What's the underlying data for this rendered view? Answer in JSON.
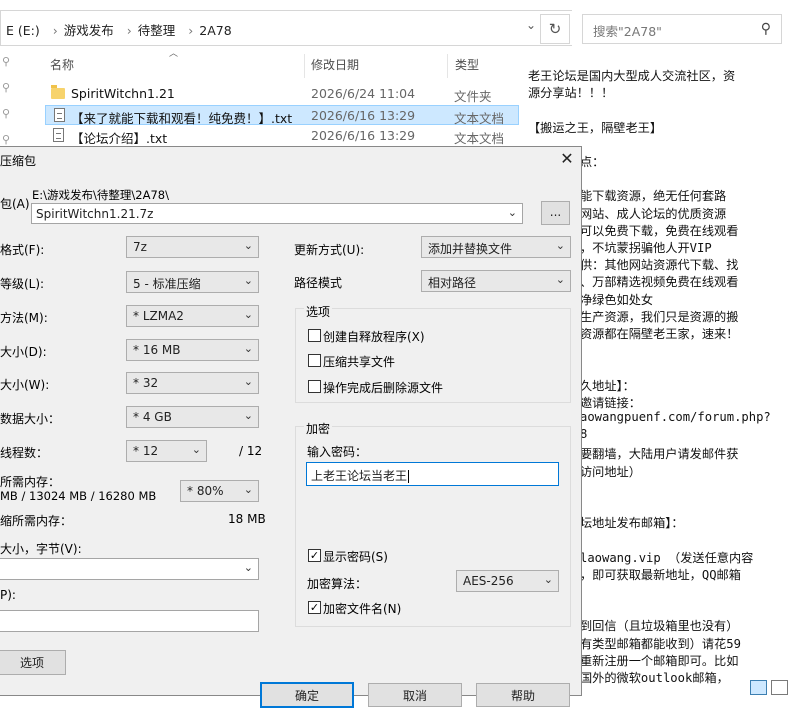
{
  "explorer": {
    "breadcrumb": [
      "E (E:)",
      "游戏发布",
      "待整理",
      "2A78"
    ],
    "search_placeholder": "搜索\"2A78\"",
    "columns": {
      "name": "名称",
      "date": "修改日期",
      "type": "类型"
    },
    "files": [
      {
        "name": "SpiritWitchn1.21",
        "date": "2026/6/24 11:04",
        "type": "文件夹",
        "icon": "folder-icon"
      },
      {
        "name": "【来了就能下载和观看！纯免费！】.txt",
        "date": "2026/6/16 13:29",
        "type": "文本文档",
        "icon": "text-file-icon"
      },
      {
        "name": "【论坛介绍】.txt",
        "date": "2026/6/16 13:29",
        "type": "文本文档",
        "icon": "text-file-icon"
      }
    ]
  },
  "preview": {
    "lines": [
      "老王论坛是国内大型成人交流社区，资",
      "源分享站！！！",
      "",
      "【搬运之王，隔壁老王】",
      "",
      "点：",
      "",
      "能下载资源，绝无任何套路",
      "网站、成人论坛的优质资源",
      "可以免费下载，免费在线观看",
      "，不坑蒙拐骗他人开VIP",
      "供：其他网站资源代下载、找",
      "、万部精选视频免费在线观看",
      "净绿色如处女",
      "生产资源，我们只是资源的搬",
      "资源都在隔壁老王家，速来！",
      "",
      "",
      "久地址】：",
      "邀请链接：",
      "aowangpuenf.com/forum.php?",
      "8",
      "要翻墙，大陆用户请发邮件获",
      "访问地址）",
      "",
      "",
      "坛地址发布邮箱】：",
      "",
      "laowang.vip  （发送任意内容",
      "，即可获取最新地址，QQ邮箱",
      "",
      "",
      "到回信（且垃圾箱里也没有）",
      "有类型邮箱都能收到）请花59",
      "重新注册一个邮箱即可。比如",
      " 国外的微软outlook邮箱，"
    ]
  },
  "dialog": {
    "title": "压缩包",
    "archive_label": "包(A)",
    "path": "E:\\游戏发布\\待整理\\2A78\\",
    "archive_name": "SpiritWitchn1.21.7z",
    "browse_label": "...",
    "format_label": "格式(F):",
    "format_value": "7z",
    "level_label": "等级(L):",
    "level_value": "5 - 标准压缩",
    "method_label": "方法(M):",
    "method_value": "* LZMA2",
    "dict_label": "大小(D):",
    "dict_value": "* 16 MB",
    "word_label": "大小(W):",
    "word_value": "* 32",
    "solid_label": "数据大小：",
    "solid_value": "* 4 GB",
    "threads_label": "线程数：",
    "threads_value": "* 12",
    "threads_total": "/ 12",
    "mem_comp_label": "所需内存：",
    "mem_comp_value": "MB / 13024 MB / 16280 MB",
    "mem_pct": "* 80%",
    "mem_decomp_label": "缩所需内存：",
    "mem_decomp_value": "18 MB",
    "split_label": "大小，字节(V):",
    "params_label": "P):",
    "options_btn": "选项",
    "update_label": "更新方式(U):",
    "update_value": "添加并替换文件",
    "path_mode_label": "路径模式",
    "path_mode_value": "相对路径",
    "options_group": "选项",
    "opt_sfx": "创建自释放程序(X)",
    "opt_shared": "压缩共享文件",
    "opt_delete": "操作完成后删除源文件",
    "enc_group": "加密",
    "pwd_label": "输入密码：",
    "pwd_value": "上老王论坛当老王",
    "show_pwd": "显示密码(S)",
    "enc_method_label": "加密算法：",
    "enc_method_value": "AES-256",
    "enc_names": "加密文件名(N)",
    "ok": "确定",
    "cancel": "取消",
    "help": "帮助"
  }
}
